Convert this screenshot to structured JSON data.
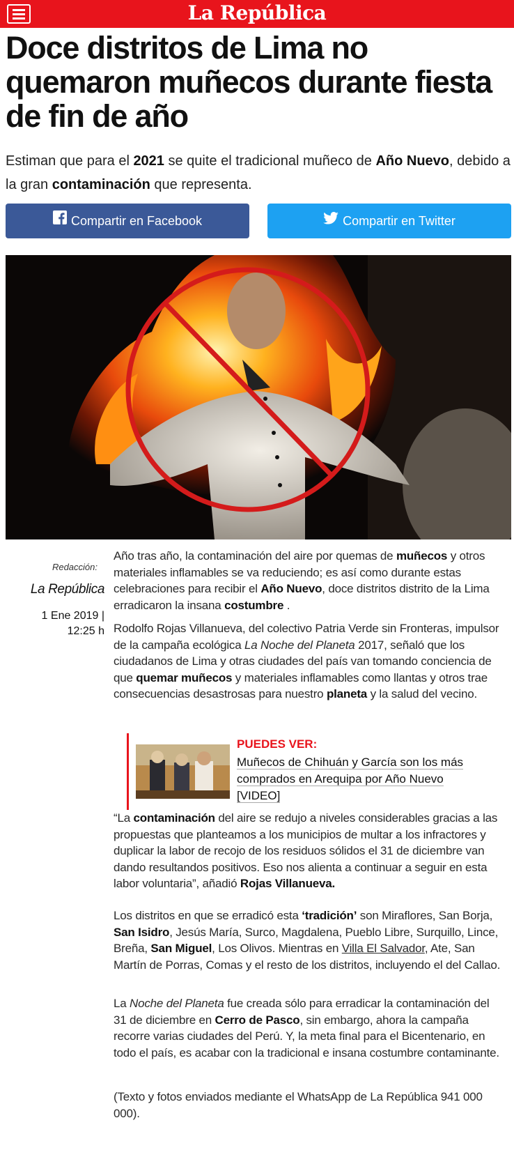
{
  "header": {
    "brand": "La República",
    "menu_icon": "hamburger-menu-icon"
  },
  "article": {
    "title": "Doce distritos de Lima no quemaron muñecos durante fiesta de fin de año",
    "subtitle": {
      "p1": "Estiman que para el ",
      "b1": "2021",
      "p2": " se quite el tradicional muñeco de ",
      "b2": "Año Nuevo",
      "p3": ", debido a la gran ",
      "b3": "contaminación",
      "p4": " que representa."
    }
  },
  "share": {
    "facebook_label": "Compartir en Facebook",
    "twitter_label": "Compartir en Twitter",
    "facebook_icon": "facebook-icon",
    "twitter_icon": "twitter-icon",
    "facebook_color": "#3b5998",
    "twitter_color": "#1da1f2"
  },
  "byline": {
    "role": "Redacción:",
    "author": "La República",
    "date": "1 Ene 2019 |",
    "time": "12:25 h"
  },
  "body": {
    "p1": {
      "t1": "Año tras año, la contaminación del aire por quemas de ",
      "b1": "muñecos",
      "t2": " y otros materiales inflamables se va reduciendo; es así como durante estas celebraciones para recibir el ",
      "b2": "Año Nuevo",
      "t3": ", doce distritos distrito de la Lima erradicaron la insana ",
      "b3": "costumbre",
      "t4": " ."
    },
    "p2": {
      "t1": "Rodolfo Rojas Villanueva, del colectivo Patria Verde sin Fronteras, impulsor de la campaña ecológica ",
      "i1": "La Noche del Planeta",
      "t2": " 2017, señaló que los ciudadanos de Lima y otras ciudades del país van tomando conciencia de que ",
      "b1": "quemar muñecos",
      "t3": " y materiales inflamables como llantas y otros trae consecuencias desastrosas para nuestro ",
      "b2": "planeta",
      "t4": " y la salud del vecino."
    },
    "p3": {
      "t1": "“La ",
      "b1": "contaminación",
      "t2": " del aire se redujo a niveles considerables gracias a las propuestas que planteamos a los municipios de multar a los infractores y duplicar la labor de recojo de los residuos sólidos el 31 de diciembre van dando resultandos positivos. Eso nos alienta a continuar a seguir en esta labor voluntaria”, añadió ",
      "b2": "Rojas Villanueva."
    },
    "p4": {
      "t1": "Los distritos en que se erradicó esta ",
      "b1": "‘tradición’",
      "t2": " son Miraflores, San Borja, ",
      "b2": "San Isidro",
      "t3": ", Jesús María, Surco, Magdalena, Pueblo Libre, Surquillo, Lince, Breña, ",
      "b3": "San Miguel",
      "t4": ", Los Olivos. Mientras en ",
      "u1": "Villa El Salvador",
      "t5": ", Ate, San Martín de Porras, Comas y el resto de los distritos, incluyendo el del Callao."
    },
    "p5": {
      "t1": "La ",
      "i1": "Noche del Planeta",
      "t2": " fue creada sólo para erradicar la contaminación del 31 de diciembre en ",
      "b1": " Cerro de Pasco",
      "t3": ", sin embargo, ahora la campaña recorre varias ciudades del Perú. Y, la meta final para el Bicentenario, en todo el país, es acabar con la tradicional e insana costumbre contaminante."
    },
    "p6": "(Texto y fotos enviados mediante el WhatsApp de La República 941 000 000)."
  },
  "related": {
    "kicker": "PUEDES VER:",
    "title": "Muñecos de Chihuán y García son los más comprados en Arequipa por Año Nuevo [VIDEO]"
  },
  "colors": {
    "brand_red": "#e8141c"
  }
}
